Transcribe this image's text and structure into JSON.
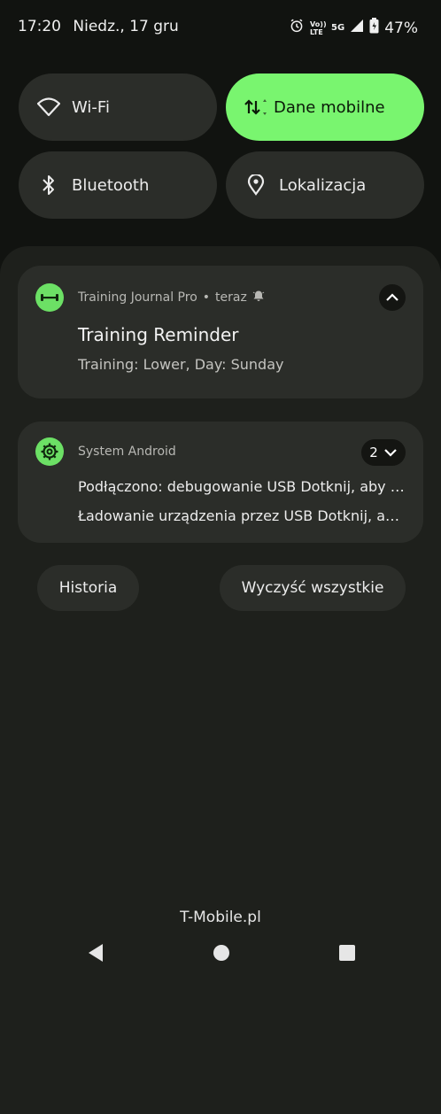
{
  "status_bar": {
    "time": "17:20",
    "date": "Niedz., 17 gru",
    "volte": "Vo)) LTE",
    "network": "5G",
    "battery": "47%",
    "icons": [
      "alarm-icon",
      "volte-icon",
      "signal-icon",
      "battery-icon"
    ]
  },
  "quick_settings": [
    {
      "label": "Wi-Fi",
      "icon": "wifi-icon",
      "active": false
    },
    {
      "label": "Dane mobilne",
      "icon": "mobile-data-icon",
      "active": true
    },
    {
      "label": "Bluetooth",
      "icon": "bluetooth-icon",
      "active": false
    },
    {
      "label": "Lokalizacja",
      "icon": "location-icon",
      "active": false
    }
  ],
  "notifications": [
    {
      "app": "Training Journal Pro",
      "time": "teraz",
      "icon": "dumbbell-icon",
      "title": "Training Reminder",
      "text": "Training: Lower, Day: Sunday"
    },
    {
      "app": "System Android",
      "icon": "gear-icon",
      "count": "2",
      "lines": [
        "Podłączono: debugowanie USB Dotknij, aby wyłączyć debugowanie USB",
        "Ładowanie urządzenia przez USB Dotknij, aby wyświetlić więcej opcji"
      ]
    }
  ],
  "actions": {
    "history": "Historia",
    "clear_all": "Wyczyść wszystkie"
  },
  "carrier": "T-Mobile.pl",
  "colors": {
    "accent": "#79f56f",
    "tile": "#2b2d29",
    "background": "#111310"
  }
}
